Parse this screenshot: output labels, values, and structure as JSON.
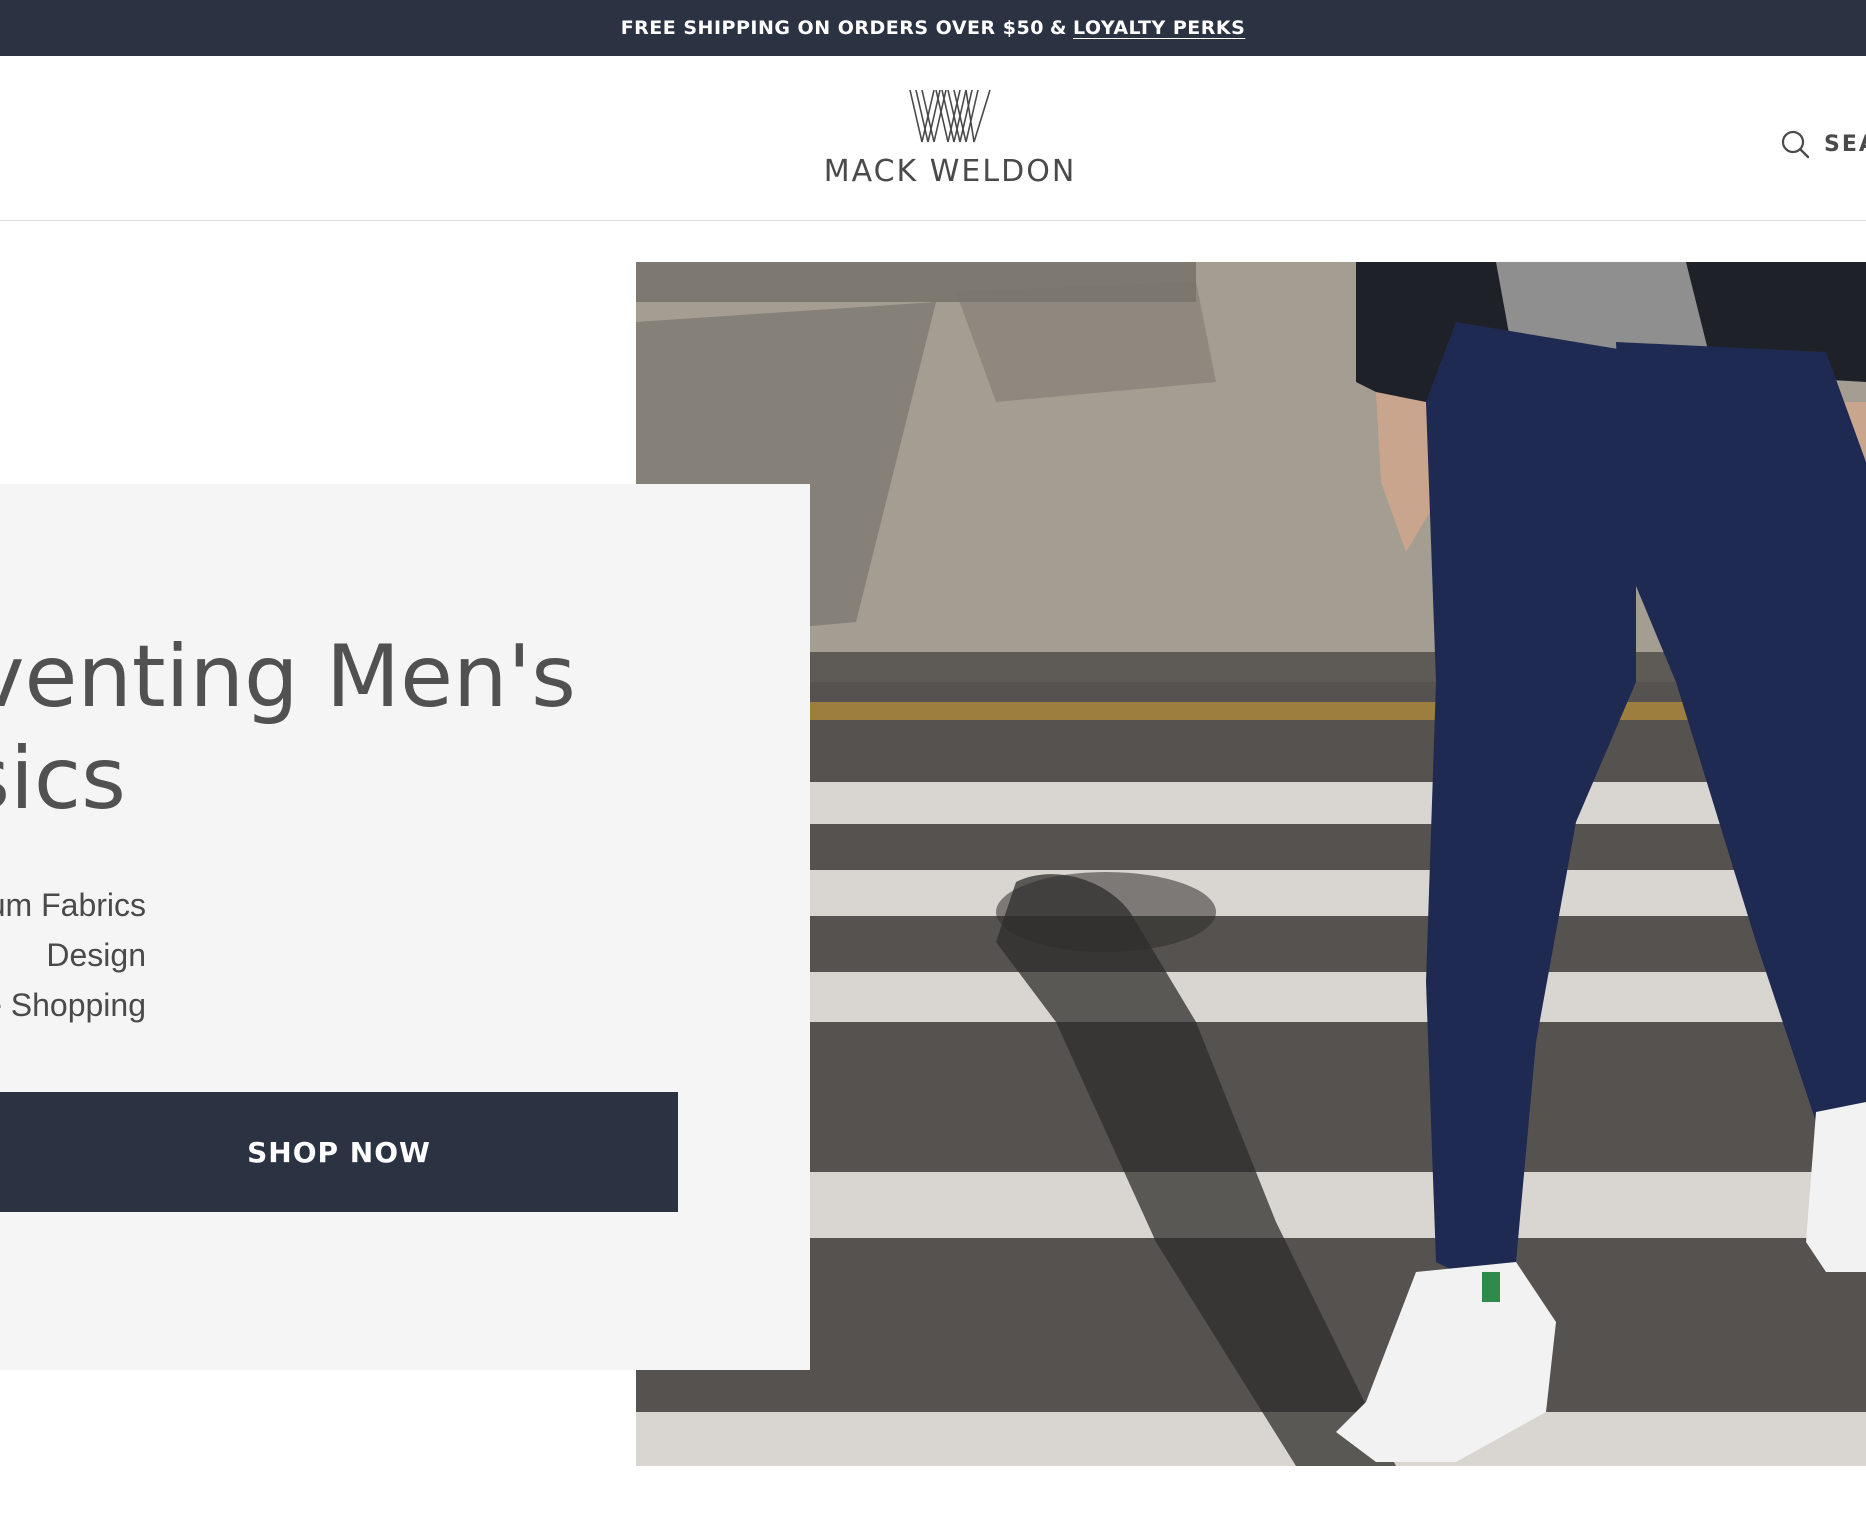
{
  "announcement": {
    "text": "FREE SHIPPING ON ORDERS OVER $50",
    "joiner": "&",
    "link_label": "LOYALTY PERKS"
  },
  "header": {
    "brand_name": "MACK WELDON",
    "logo_icon": "mw-monogram-icon",
    "search_label": "SEA",
    "search_icon": "search-icon"
  },
  "hero": {
    "title_line1": "nventing Men's",
    "title_line2": "sics",
    "features": [
      "um Fabrics",
      "Design",
      "e Shopping"
    ],
    "cta_label": "SHOP NOW",
    "image_icon": "hero-photo"
  },
  "colors": {
    "brand_navy": "#2b3242",
    "panel_gray": "#f5f5f5",
    "text_gray": "#4a4a4a"
  }
}
